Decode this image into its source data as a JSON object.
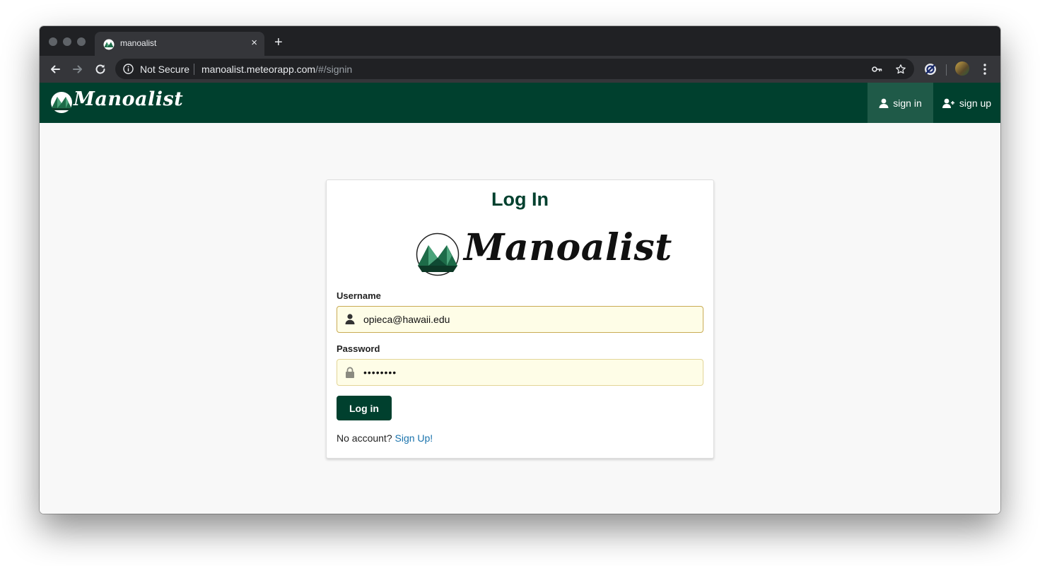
{
  "browser": {
    "tab_title": "manoalist",
    "tab_close": "×",
    "new_tab": "+",
    "security_label": "Not Secure",
    "url_host": "manoalist.meteorapp.com",
    "url_path": "/#/signin"
  },
  "navbar": {
    "brand": "Manoalist",
    "sign_in": "sign in",
    "sign_up": "sign up"
  },
  "login": {
    "title": "Log In",
    "logo_text": "Manoalist",
    "username_label": "Username",
    "username_value": "opieca@hawaii.edu",
    "password_label": "Password",
    "password_value": "••••••••",
    "submit_label": "Log in",
    "no_account_text": "No account? ",
    "signup_link": "Sign Up!"
  },
  "colors": {
    "brand_green": "#00402e",
    "active_nav": "#1f5a48",
    "link_blue": "#1a73ad",
    "autofill_yellow": "#fefde7"
  },
  "icons": {
    "user": "user-icon",
    "lock": "lock-icon",
    "add_user": "add-user-icon",
    "key": "key-icon",
    "star": "star-icon",
    "menu": "more-vert-icon"
  }
}
